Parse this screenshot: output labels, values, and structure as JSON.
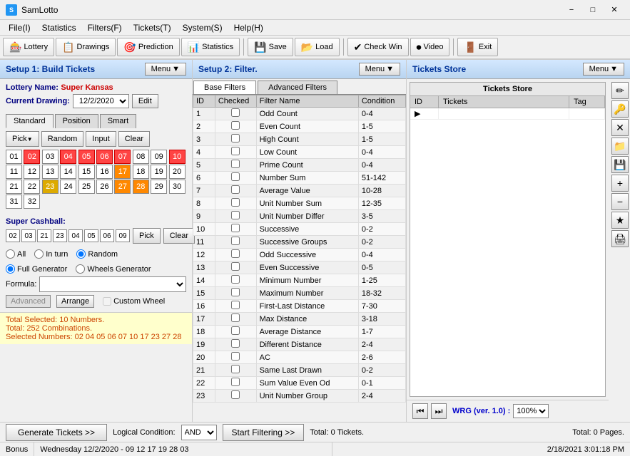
{
  "titlebar": {
    "app_name": "SamLotto",
    "icon": "S"
  },
  "menubar": {
    "items": [
      {
        "id": "file",
        "label": "File(I)"
      },
      {
        "id": "statistics",
        "label": "Statistics"
      },
      {
        "id": "filters",
        "label": "Filters(F)"
      },
      {
        "id": "tickets",
        "label": "Tickets(T)"
      },
      {
        "id": "system",
        "label": "System(S)"
      },
      {
        "id": "help",
        "label": "Help(H)"
      }
    ]
  },
  "toolbar": {
    "buttons": [
      {
        "id": "lottery",
        "label": "Lottery",
        "icon": "🎰"
      },
      {
        "id": "drawings",
        "label": "Drawings",
        "icon": "📋"
      },
      {
        "id": "prediction",
        "label": "Prediction",
        "icon": "🎯"
      },
      {
        "id": "statistics",
        "label": "Statistics",
        "icon": "📊"
      },
      {
        "id": "save",
        "label": "Save",
        "icon": "💾"
      },
      {
        "id": "load",
        "label": "Load",
        "icon": "📂"
      },
      {
        "id": "check-win",
        "label": "Check Win",
        "icon": "✔"
      },
      {
        "id": "video",
        "label": "Video",
        "icon": "⏺"
      },
      {
        "id": "exit",
        "label": "Exit",
        "icon": "🚪"
      }
    ]
  },
  "left_panel": {
    "title": "Setup 1: Build  Tickets",
    "menu_label": "Menu",
    "lottery_name_label": "Lottery  Name:",
    "lottery_name": "Super Kansas",
    "current_drawing_label": "Current Drawing:",
    "current_drawing": "12/2/2020",
    "edit_label": "Edit",
    "tabs": [
      {
        "id": "standard",
        "label": "Standard"
      },
      {
        "id": "position",
        "label": "Position"
      },
      {
        "id": "smart",
        "label": "Smart"
      }
    ],
    "controls": {
      "pick_label": "Pick",
      "random_label": "Random",
      "input_label": "Input",
      "clear_label": "Clear"
    },
    "numbers": [
      {
        "val": "01",
        "state": "normal"
      },
      {
        "val": "02",
        "state": "red"
      },
      {
        "val": "03",
        "state": "normal"
      },
      {
        "val": "04",
        "state": "red"
      },
      {
        "val": "05",
        "state": "red"
      },
      {
        "val": "06",
        "state": "red"
      },
      {
        "val": "07",
        "state": "red"
      },
      {
        "val": "08",
        "state": "normal"
      },
      {
        "val": "09",
        "state": "normal"
      },
      {
        "val": "10",
        "state": "red"
      },
      {
        "val": "11",
        "state": "normal"
      },
      {
        "val": "12",
        "state": "normal"
      },
      {
        "val": "13",
        "state": "normal"
      },
      {
        "val": "14",
        "state": "normal"
      },
      {
        "val": "15",
        "state": "normal"
      },
      {
        "val": "16",
        "state": "normal"
      },
      {
        "val": "17",
        "state": "orange"
      },
      {
        "val": "18",
        "state": "normal"
      },
      {
        "val": "19",
        "state": "normal"
      },
      {
        "val": "20",
        "state": "normal"
      },
      {
        "val": "21",
        "state": "normal"
      },
      {
        "val": "22",
        "state": "normal"
      },
      {
        "val": "23",
        "state": "yellow"
      },
      {
        "val": "24",
        "state": "normal"
      },
      {
        "val": "25",
        "state": "normal"
      },
      {
        "val": "26",
        "state": "normal"
      },
      {
        "val": "27",
        "state": "orange"
      },
      {
        "val": "28",
        "state": "orange"
      },
      {
        "val": "29",
        "state": "normal"
      },
      {
        "val": "30",
        "state": "normal"
      },
      {
        "val": "31",
        "state": "normal"
      },
      {
        "val": "32",
        "state": "normal"
      }
    ],
    "cashball": {
      "label": "Super Cashball:",
      "numbers": [
        "02",
        "03",
        "21",
        "23",
        "04",
        "05",
        "06",
        "09"
      ],
      "pick_label": "Pick",
      "clear_label": "Clear"
    },
    "radio_options": [
      {
        "id": "all",
        "label": "All",
        "checked": false
      },
      {
        "id": "in-turn",
        "label": "In turn",
        "checked": false
      },
      {
        "id": "random",
        "label": "Random",
        "checked": true
      }
    ],
    "generator": {
      "full_gen": "Full Generator",
      "wheels_gen": "Wheels Generator",
      "formula_label": "Formula:",
      "formula_value": "",
      "advanced_label": "Advanced",
      "arrange_label": "Arrange",
      "custom_wheel_label": "Custom Wheel"
    },
    "summary": {
      "line1": "Total Selected: 10 Numbers.",
      "line2": "Total: 252 Combinations.",
      "line3": "Selected Numbers: 02 04 05 06 07 10 17 23 27 28"
    }
  },
  "mid_panel": {
    "title": "Setup 2: Filter.",
    "menu_label": "Menu",
    "filter_tabs": [
      {
        "id": "base",
        "label": "Base Filters"
      },
      {
        "id": "advanced",
        "label": "Advanced Filters"
      }
    ],
    "table_headers": [
      "ID",
      "Checked",
      "Filter Name",
      "Condition"
    ],
    "filters": [
      {
        "id": "1",
        "name": "Odd Count",
        "condition": "0-4"
      },
      {
        "id": "2",
        "name": "Even Count",
        "condition": "1-5"
      },
      {
        "id": "3",
        "name": "High Count",
        "condition": "1-5"
      },
      {
        "id": "4",
        "name": "Low Count",
        "condition": "0-4"
      },
      {
        "id": "5",
        "name": "Prime Count",
        "condition": "0-4"
      },
      {
        "id": "6",
        "name": "Number Sum",
        "condition": "51-142"
      },
      {
        "id": "7",
        "name": "Average Value",
        "condition": "10-28"
      },
      {
        "id": "8",
        "name": "Unit Number Sum",
        "condition": "12-35"
      },
      {
        "id": "9",
        "name": "Unit Number Differ",
        "condition": "3-5"
      },
      {
        "id": "10",
        "name": "Successive",
        "condition": "0-2"
      },
      {
        "id": "11",
        "name": "Successive Groups",
        "condition": "0-2"
      },
      {
        "id": "12",
        "name": "Odd Successive",
        "condition": "0-4"
      },
      {
        "id": "13",
        "name": "Even Successive",
        "condition": "0-5"
      },
      {
        "id": "14",
        "name": "Minimum Number",
        "condition": "1-25"
      },
      {
        "id": "15",
        "name": "Maximum Number",
        "condition": "18-32"
      },
      {
        "id": "16",
        "name": "First-Last Distance",
        "condition": "7-30"
      },
      {
        "id": "17",
        "name": "Max Distance",
        "condition": "3-18"
      },
      {
        "id": "18",
        "name": "Average Distance",
        "condition": "1-7"
      },
      {
        "id": "19",
        "name": "Different Distance",
        "condition": "2-4"
      },
      {
        "id": "20",
        "name": "AC",
        "condition": "2-6"
      },
      {
        "id": "21",
        "name": "Same Last Drawn",
        "condition": "0-2"
      },
      {
        "id": "22",
        "name": "Sum Value Even Od",
        "condition": "0-1"
      },
      {
        "id": "23",
        "name": "Unit Number Group",
        "condition": "2-4"
      }
    ]
  },
  "right_panel": {
    "title": "Tickets Store",
    "menu_label": "Menu",
    "inner_title": "Tickets Store",
    "col_id": "ID",
    "col_tickets": "Tickets",
    "col_tag": "Tag",
    "version": "WRG (ver. 1.0) :",
    "zoom": "100%",
    "side_buttons": [
      {
        "id": "edit-icon",
        "symbol": "✏"
      },
      {
        "id": "properties-icon",
        "symbol": "🔑"
      },
      {
        "id": "delete-icon",
        "symbol": "✕"
      },
      {
        "id": "open-icon",
        "symbol": "📁"
      },
      {
        "id": "save-icon",
        "symbol": "💾"
      },
      {
        "id": "add-icon",
        "symbol": "+"
      },
      {
        "id": "minus-icon",
        "symbol": "−"
      },
      {
        "id": "star-icon",
        "symbol": "★"
      },
      {
        "id": "print-icon",
        "symbol": "🖨"
      }
    ]
  },
  "bottom_bar": {
    "gen_tickets_label": "Generate Tickets >>",
    "logical_label": "Logical Condition:",
    "logical_value": "AND",
    "start_filter_label": "Start Filtering >>",
    "total_label": "Total: 0 Tickets.",
    "total_pages_label": "Total: 0 Pages."
  },
  "statusbar": {
    "bonus": "Bonus",
    "datetime": "Wednesday 12/2/2020 - 09 12 17 19 28 03",
    "app_datetime": "2/18/2021  3:01:18 PM"
  }
}
